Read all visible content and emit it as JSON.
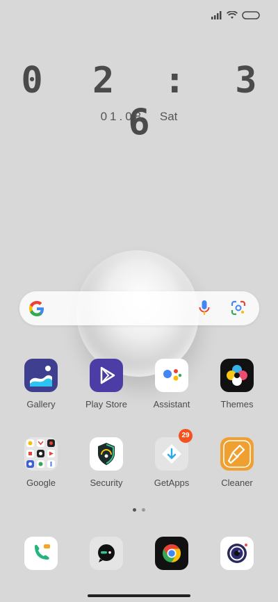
{
  "clock": {
    "time": "0 2 : 3 6",
    "date": "01.08",
    "day": "Sat"
  },
  "status_icons": [
    "signal-icon",
    "wifi-icon",
    "battery-icon"
  ],
  "search": {
    "engine": "google-logo",
    "mic": "mic-icon",
    "lens": "lens-icon"
  },
  "apps_row1": [
    {
      "label": "Gallery",
      "icon": "gallery-icon"
    },
    {
      "label": "Play Store",
      "icon": "play-store-icon"
    },
    {
      "label": "Assistant",
      "icon": "assistant-icon"
    },
    {
      "label": "Themes",
      "icon": "themes-icon"
    }
  ],
  "apps_row2": [
    {
      "label": "Google",
      "icon": "google-folder-icon"
    },
    {
      "label": "Security",
      "icon": "security-icon"
    },
    {
      "label": "GetApps",
      "icon": "getapps-icon",
      "badge": "29"
    },
    {
      "label": "Cleaner",
      "icon": "cleaner-icon"
    }
  ],
  "dock": [
    {
      "icon": "phone-icon"
    },
    {
      "icon": "messages-icon"
    },
    {
      "icon": "chrome-icon"
    },
    {
      "icon": "camera-icon"
    }
  ],
  "pages": {
    "count": 2,
    "active": 0
  }
}
